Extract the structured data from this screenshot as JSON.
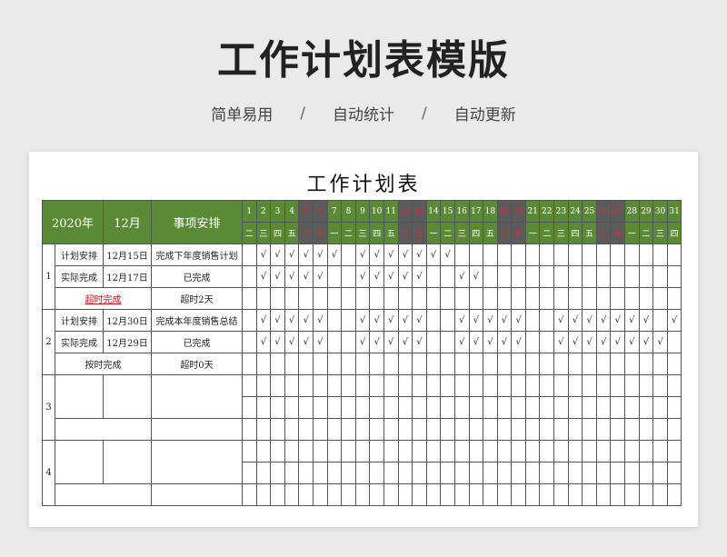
{
  "hero": {
    "title": "工作计划表模版",
    "tags": [
      "简单易用",
      "自动统计",
      "自动更新"
    ],
    "separator": "/"
  },
  "sheet": {
    "title": "工作计划表",
    "year_label": "2020年",
    "month_label": "12月",
    "item_header": "事项安排",
    "days": [
      "1",
      "2",
      "3",
      "4",
      "5",
      "6",
      "7",
      "8",
      "9",
      "10",
      "11",
      "12",
      "13",
      "14",
      "15",
      "16",
      "17",
      "18",
      "19",
      "20",
      "21",
      "22",
      "23",
      "24",
      "25",
      "26",
      "27",
      "28",
      "29",
      "30",
      "31"
    ],
    "weekdays": [
      "二",
      "三",
      "四",
      "五",
      "六",
      "日",
      "一",
      "二",
      "三",
      "四",
      "五",
      "六",
      "日",
      "一",
      "二",
      "三",
      "四",
      "五",
      "六",
      "日",
      "一",
      "二",
      "三",
      "四",
      "五",
      "六",
      "日",
      "一",
      "二",
      "三",
      "四"
    ],
    "weekend_days": [
      5,
      6,
      12,
      13,
      19,
      20,
      26,
      27
    ],
    "check_mark": "√",
    "groups": [
      {
        "no": "1",
        "rows": [
          {
            "label": "计划安排",
            "date": "12月15日",
            "item": "完成下年度销售计划",
            "checks": [
              2,
              3,
              4,
              5,
              6,
              7,
              9,
              10,
              11,
              12,
              13,
              14,
              15
            ]
          },
          {
            "label": "实际完成",
            "date": "12月17日",
            "item": "已完成",
            "checks": [
              2,
              3,
              4,
              5,
              6,
              9,
              10,
              11,
              12,
              13,
              16,
              17
            ]
          }
        ],
        "status_label": "超时完成",
        "status_value": "超时2天",
        "status_link": true
      },
      {
        "no": "2",
        "rows": [
          {
            "label": "计划安排",
            "date": "12月30日",
            "item": "完成本年度销售总结",
            "checks": [
              2,
              3,
              4,
              5,
              6,
              9,
              10,
              11,
              12,
              13,
              16,
              17,
              18,
              19,
              20,
              23,
              24,
              25,
              26,
              27,
              28,
              29,
              31
            ]
          },
          {
            "label": "实际完成",
            "date": "12月29日",
            "item": "已完成",
            "checks": [
              2,
              3,
              4,
              5,
              6,
              9,
              10,
              11,
              12,
              13,
              16,
              17,
              18,
              19,
              20,
              23,
              24,
              25,
              26,
              27,
              28,
              29,
              30
            ]
          }
        ],
        "status_label": "按时完成",
        "status_value": "超时0天",
        "status_link": false
      },
      {
        "no": "3",
        "rows": [],
        "status_label": "",
        "status_value": "",
        "status_link": false
      },
      {
        "no": "4",
        "rows": [],
        "status_label": "",
        "status_value": "",
        "status_link": false
      }
    ]
  }
}
